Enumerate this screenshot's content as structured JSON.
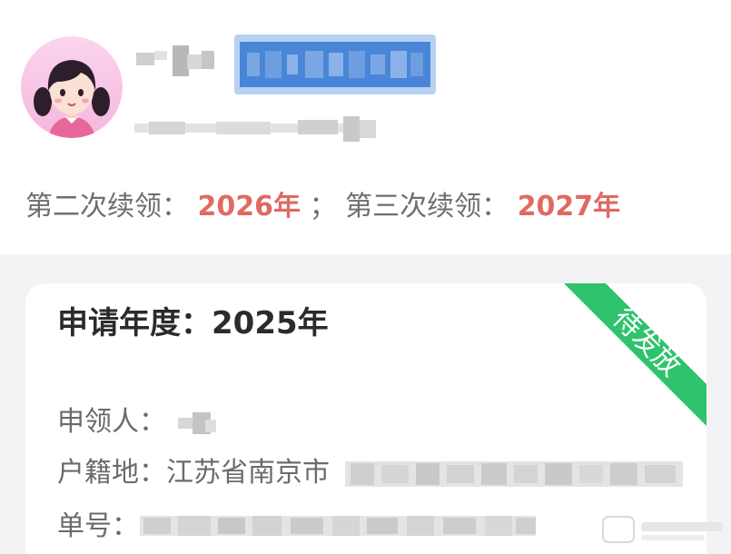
{
  "profile": {
    "avatar_icon": "girl-avatar-icon",
    "name_masked": true,
    "phone_masked": true,
    "subtitle_masked": true
  },
  "renewal": {
    "second_label": "第二次续领：",
    "second_year": "2026年",
    "separator": "；",
    "third_label": "第三次续领：",
    "third_year": "2027年"
  },
  "card": {
    "title": "申请年度：2025年",
    "status_badge": "待发放",
    "applicant_label": "申领人：",
    "household_label": "户籍地：",
    "household_value": "江苏省南京市",
    "order_label": "单号：",
    "colors": {
      "badge": "#2ec36c",
      "year_accent": "#e06a62"
    }
  }
}
